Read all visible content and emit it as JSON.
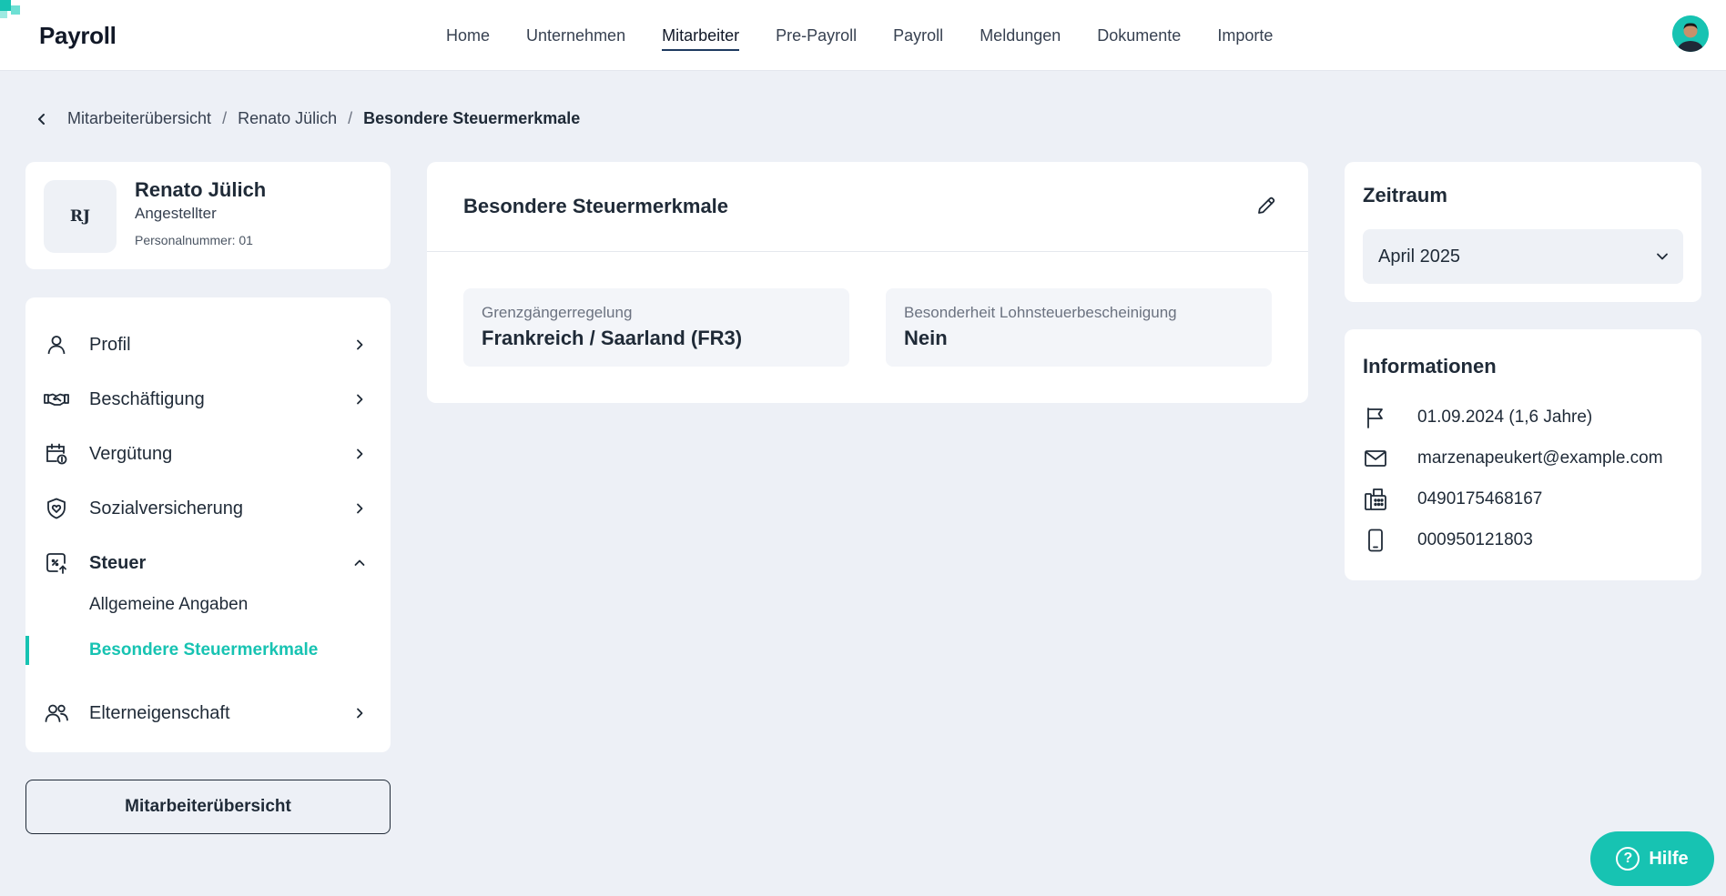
{
  "app": {
    "brand": "Payroll"
  },
  "colors": {
    "accent": "#17c3b2",
    "navy": "#1e3a5f",
    "background": "#edf0f6"
  },
  "nav": {
    "items": [
      {
        "label": "Home"
      },
      {
        "label": "Unternehmen"
      },
      {
        "label": "Mitarbeiter"
      },
      {
        "label": "Pre-Payroll"
      },
      {
        "label": "Payroll"
      },
      {
        "label": "Meldungen"
      },
      {
        "label": "Dokumente"
      },
      {
        "label": "Importe"
      }
    ],
    "active": "Mitarbeiter"
  },
  "breadcrumb": {
    "items": [
      "Mitarbeiterübersicht",
      "Renato Jülich",
      "Besondere Steuermerkmale"
    ],
    "separator": "/"
  },
  "employee": {
    "initials": "RJ",
    "name": "Renato Jülich",
    "role": "Angestellter",
    "personnel_number": "Personalnummer: 01"
  },
  "sidebar": {
    "items": [
      {
        "label": "Profil",
        "icon": "user-icon"
      },
      {
        "label": "Beschäftigung",
        "icon": "handshake-icon"
      },
      {
        "label": "Vergütung",
        "icon": "calendar-money-icon"
      },
      {
        "label": "Sozialversicherung",
        "icon": "shield-heart-icon"
      },
      {
        "label": "Steuer",
        "icon": "tax-icon",
        "expanded": true
      },
      {
        "label": "Elterneigenschaft",
        "icon": "people-icon"
      }
    ],
    "sub_items": [
      {
        "label": "Allgemeine Angaben"
      },
      {
        "label": "Besondere Steuermerkmale",
        "active": true
      }
    ],
    "overview_button": "Mitarbeiterübersicht"
  },
  "main": {
    "title": "Besondere Steuermerkmale",
    "fields": [
      {
        "label": "Grenzgängerregelung",
        "value": "Frankreich / Saarland (FR3)"
      },
      {
        "label": "Besonderheit Lohnsteuerbescheinigung",
        "value": "Nein"
      }
    ]
  },
  "period": {
    "title": "Zeitraum",
    "selected": "April 2025"
  },
  "info": {
    "title": "Informationen",
    "rows": [
      {
        "icon": "flag-icon",
        "text": "01.09.2024 (1,6 Jahre)"
      },
      {
        "icon": "mail-icon",
        "text": "marzenapeukert@example.com"
      },
      {
        "icon": "fax-icon",
        "text": "0490175468167"
      },
      {
        "icon": "mobile-icon",
        "text": "000950121803"
      }
    ]
  },
  "help": {
    "label": "Hilfe",
    "icon_glyph": "?"
  }
}
